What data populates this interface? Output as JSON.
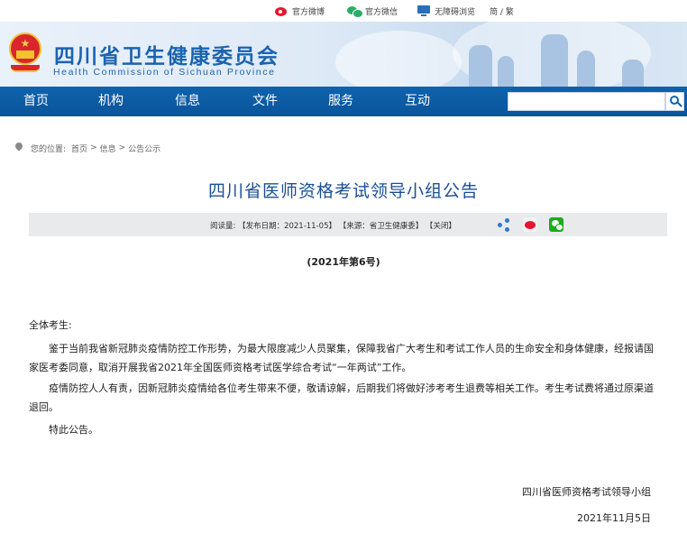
{
  "topbar": {
    "weibo": "官方微博",
    "weixin": "官方微信",
    "accessibility": "无障碍浏览",
    "language": "简 / 繁"
  },
  "header": {
    "title": "四川省卫生健康委员会",
    "subtitle": "Health Commission of Sichuan Province"
  },
  "nav": {
    "items": [
      {
        "label": "首页"
      },
      {
        "label": "机构"
      },
      {
        "label": "信息"
      },
      {
        "label": "文件"
      },
      {
        "label": "服务"
      },
      {
        "label": "互动"
      }
    ],
    "search_placeholder": ""
  },
  "breadcrumb": {
    "prefix": "您的位置:",
    "items": [
      "首页",
      "信息",
      "公告公示"
    ],
    "separator": ">"
  },
  "article": {
    "title": "四川省医师资格考试领导小组公告",
    "info": {
      "reads": "阅读量:",
      "date": "【发布日期：2021-11-05】",
      "source": "【来源：省卫生健康委】",
      "close": "【关闭】"
    },
    "doc_number": "(2021年第6号)",
    "greeting": "全体考生:",
    "paragraphs": [
      "鉴于当前我省新冠肺炎疫情防控工作形势，为最大限度减少人员聚集，保障我省广大考生和考试工作人员的生命安全和身体健康，经报请国家医考委同意，取消开展我省2021年全国医师资格考试医学综合考试“一年两试”工作。",
      "疫情防控人人有责，因新冠肺炎疫情给各位考生带来不便，敬请谅解，后期我们将做好涉考考生退费等相关工作。考生考试费将通过原渠道退回。",
      "特此公告。"
    ],
    "signature": "四川省医师资格考试领导小组",
    "sign_date": "2021年11月5日"
  },
  "colors": {
    "nav": "#0f62ad",
    "title": "#1b4f95",
    "brand": "#1b63b0"
  }
}
